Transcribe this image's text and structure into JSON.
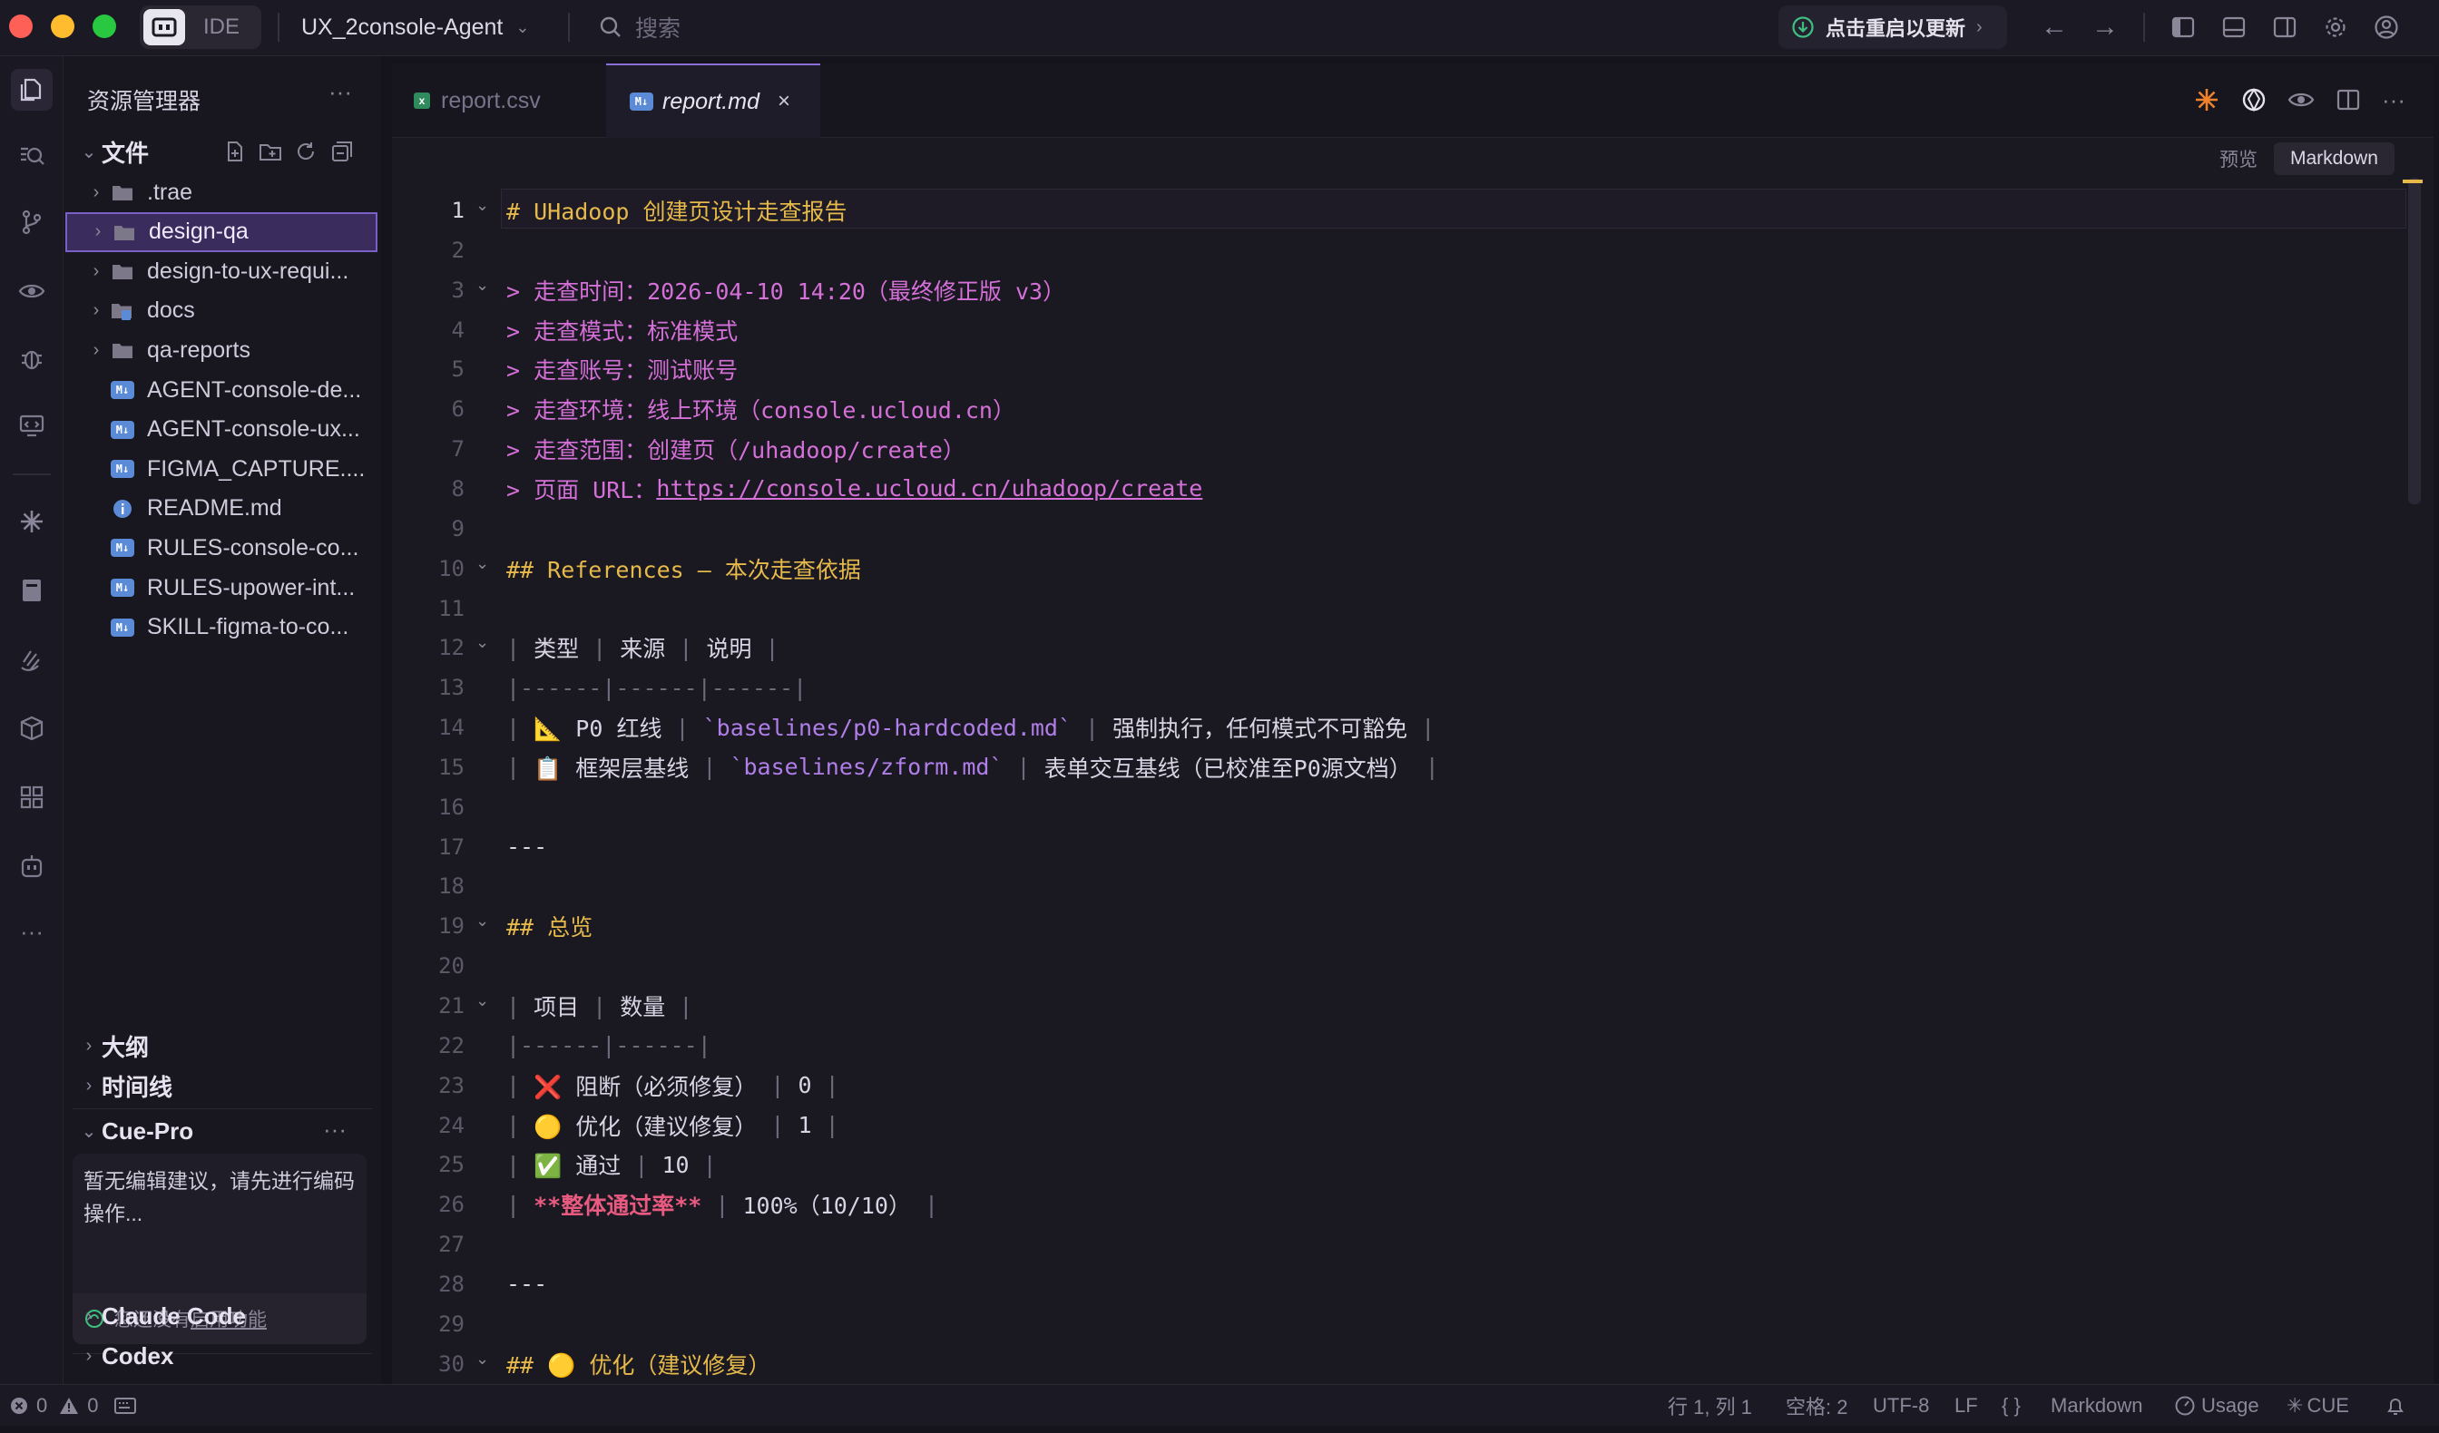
{
  "titlebar": {
    "ide_label": "IDE",
    "project": "UX_2console-Agent",
    "search_placeholder": "搜索",
    "update_label": "点击重启以更新"
  },
  "sidebar": {
    "title": "资源管理器",
    "section_files": "文件",
    "items": [
      {
        "label": ".trae",
        "type": "folder"
      },
      {
        "label": "design-qa",
        "type": "folder"
      },
      {
        "label": "design-to-ux-requi...",
        "type": "folder"
      },
      {
        "label": "docs",
        "type": "folder"
      },
      {
        "label": "qa-reports",
        "type": "folder"
      },
      {
        "label": "AGENT-console-de...",
        "type": "md"
      },
      {
        "label": "AGENT-console-ux...",
        "type": "md"
      },
      {
        "label": "FIGMA_CAPTURE....",
        "type": "md"
      },
      {
        "label": "README.md",
        "type": "info"
      },
      {
        "label": "RULES-console-co...",
        "type": "md"
      },
      {
        "label": "RULES-upower-int...",
        "type": "md"
      },
      {
        "label": "SKILL-figma-to-co...",
        "type": "md"
      }
    ],
    "outline": "大纲",
    "timeline": "时间线",
    "cue_pro": "Cue-Pro",
    "cue_text": "暂无编辑建议，请先进行编码操作...",
    "cue_hint_prefix": "您还没有",
    "cue_hint_link": "启用功能",
    "claude_code": "Claude Code",
    "codex": "Codex"
  },
  "tabs": [
    {
      "label": "report.csv",
      "active": false
    },
    {
      "label": "report.md",
      "active": true
    }
  ],
  "editor": {
    "view_preview": "预览",
    "view_markdown": "Markdown",
    "lines": [
      {
        "n": "1",
        "fold": true,
        "segs": [
          {
            "c": "c-head",
            "t": "# UHadoop 创建页设计走查报告"
          }
        ]
      },
      {
        "n": "2",
        "segs": []
      },
      {
        "n": "3",
        "fold": true,
        "segs": [
          {
            "c": "c-quote",
            "t": "> 走查时间：2026-04-10 14:20（最终修正版 v3）"
          }
        ]
      },
      {
        "n": "4",
        "segs": [
          {
            "c": "c-quote",
            "t": "> 走查模式：标准模式"
          }
        ]
      },
      {
        "n": "5",
        "segs": [
          {
            "c": "c-quote",
            "t": "> 走查账号：测试账号"
          }
        ]
      },
      {
        "n": "6",
        "segs": [
          {
            "c": "c-quote",
            "t": "> 走查环境：线上环境（console.ucloud.cn）"
          }
        ]
      },
      {
        "n": "7",
        "segs": [
          {
            "c": "c-quote",
            "t": "> 走查范围：创建页（/uhadoop/create）"
          }
        ]
      },
      {
        "n": "8",
        "segs": [
          {
            "c": "c-quote",
            "t": "> 页面 URL："
          },
          {
            "c": "c-link",
            "t": "https://console.ucloud.cn/uhadoop/create"
          }
        ]
      },
      {
        "n": "9",
        "segs": []
      },
      {
        "n": "10",
        "fold": true,
        "segs": [
          {
            "c": "c-head",
            "t": "## References — 本次走查依据"
          }
        ]
      },
      {
        "n": "11",
        "segs": []
      },
      {
        "n": "12",
        "fold": true,
        "segs": [
          {
            "c": "c-pipe",
            "t": "| "
          },
          {
            "c": "",
            "t": "类型"
          },
          {
            "c": "c-pipe",
            "t": " | "
          },
          {
            "c": "",
            "t": "来源"
          },
          {
            "c": "c-pipe",
            "t": " | "
          },
          {
            "c": "",
            "t": "说明"
          },
          {
            "c": "c-pipe",
            "t": " |"
          }
        ]
      },
      {
        "n": "13",
        "segs": [
          {
            "c": "c-pipe",
            "t": "|------|------|------|"
          }
        ]
      },
      {
        "n": "14",
        "segs": [
          {
            "c": "c-pipe",
            "t": "| "
          },
          {
            "c": "",
            "t": "📐 P0 红线"
          },
          {
            "c": "c-pipe",
            "t": " | "
          },
          {
            "c": "c-code",
            "t": "`baselines/p0-hardcoded.md`"
          },
          {
            "c": "c-pipe",
            "t": " | "
          },
          {
            "c": "",
            "t": "强制执行，任何模式不可豁免"
          },
          {
            "c": "c-pipe",
            "t": " |"
          }
        ]
      },
      {
        "n": "15",
        "segs": [
          {
            "c": "c-pipe",
            "t": "| "
          },
          {
            "c": "",
            "t": "📋 框架层基线"
          },
          {
            "c": "c-pipe",
            "t": " | "
          },
          {
            "c": "c-code",
            "t": "`baselines/zform.md`"
          },
          {
            "c": "c-pipe",
            "t": " | "
          },
          {
            "c": "",
            "t": "表单交互基线（已校准至P0源文档）"
          },
          {
            "c": "c-pipe",
            "t": " |"
          }
        ]
      },
      {
        "n": "16",
        "segs": []
      },
      {
        "n": "17",
        "segs": [
          {
            "c": "",
            "t": "---"
          }
        ]
      },
      {
        "n": "18",
        "segs": []
      },
      {
        "n": "19",
        "fold": true,
        "segs": [
          {
            "c": "c-head",
            "t": "## 总览"
          }
        ]
      },
      {
        "n": "20",
        "segs": []
      },
      {
        "n": "21",
        "fold": true,
        "segs": [
          {
            "c": "c-pipe",
            "t": "| "
          },
          {
            "c": "",
            "t": "项目"
          },
          {
            "c": "c-pipe",
            "t": " | "
          },
          {
            "c": "",
            "t": "数量"
          },
          {
            "c": "c-pipe",
            "t": " |"
          }
        ]
      },
      {
        "n": "22",
        "segs": [
          {
            "c": "c-pipe",
            "t": "|------|------|"
          }
        ]
      },
      {
        "n": "23",
        "segs": [
          {
            "c": "c-pipe",
            "t": "| "
          },
          {
            "c": "",
            "t": "❌ 阻断（必须修复）"
          },
          {
            "c": "c-pipe",
            "t": " | "
          },
          {
            "c": "",
            "t": "0"
          },
          {
            "c": "c-pipe",
            "t": " |"
          }
        ]
      },
      {
        "n": "24",
        "segs": [
          {
            "c": "c-pipe",
            "t": "| "
          },
          {
            "c": "",
            "t": "🟡 优化（建议修复）"
          },
          {
            "c": "c-pipe",
            "t": " | "
          },
          {
            "c": "",
            "t": "1"
          },
          {
            "c": "c-pipe",
            "t": " |"
          }
        ]
      },
      {
        "n": "25",
        "segs": [
          {
            "c": "c-pipe",
            "t": "| "
          },
          {
            "c": "",
            "t": "✅ 通过"
          },
          {
            "c": "c-pipe",
            "t": " | "
          },
          {
            "c": "",
            "t": "10"
          },
          {
            "c": "c-pipe",
            "t": " |"
          }
        ]
      },
      {
        "n": "26",
        "segs": [
          {
            "c": "c-pipe",
            "t": "| "
          },
          {
            "c": "c-bold",
            "t": "**整体通过率**"
          },
          {
            "c": "c-pipe",
            "t": " | "
          },
          {
            "c": "",
            "t": "100%（10/10）"
          },
          {
            "c": "c-pipe",
            "t": " |"
          }
        ]
      },
      {
        "n": "27",
        "segs": []
      },
      {
        "n": "28",
        "segs": [
          {
            "c": "",
            "t": "---"
          }
        ]
      },
      {
        "n": "29",
        "segs": []
      },
      {
        "n": "30",
        "fold": true,
        "segs": [
          {
            "c": "c-head",
            "t": "## 🟡 优化（建议修复）"
          }
        ]
      }
    ]
  },
  "statusbar": {
    "errors": "0",
    "warnings": "0",
    "position": "行 1, 列 1",
    "spaces": "空格: 2",
    "encoding": "UTF-8",
    "eol": "LF",
    "braces": "{ }",
    "language": "Markdown",
    "usage": "Usage",
    "cue": "CUE"
  },
  "colors": {
    "accent": "#8a6fd8",
    "heading": "#e6b94b",
    "quote": "#d470d8",
    "bold": "#e85a80"
  }
}
